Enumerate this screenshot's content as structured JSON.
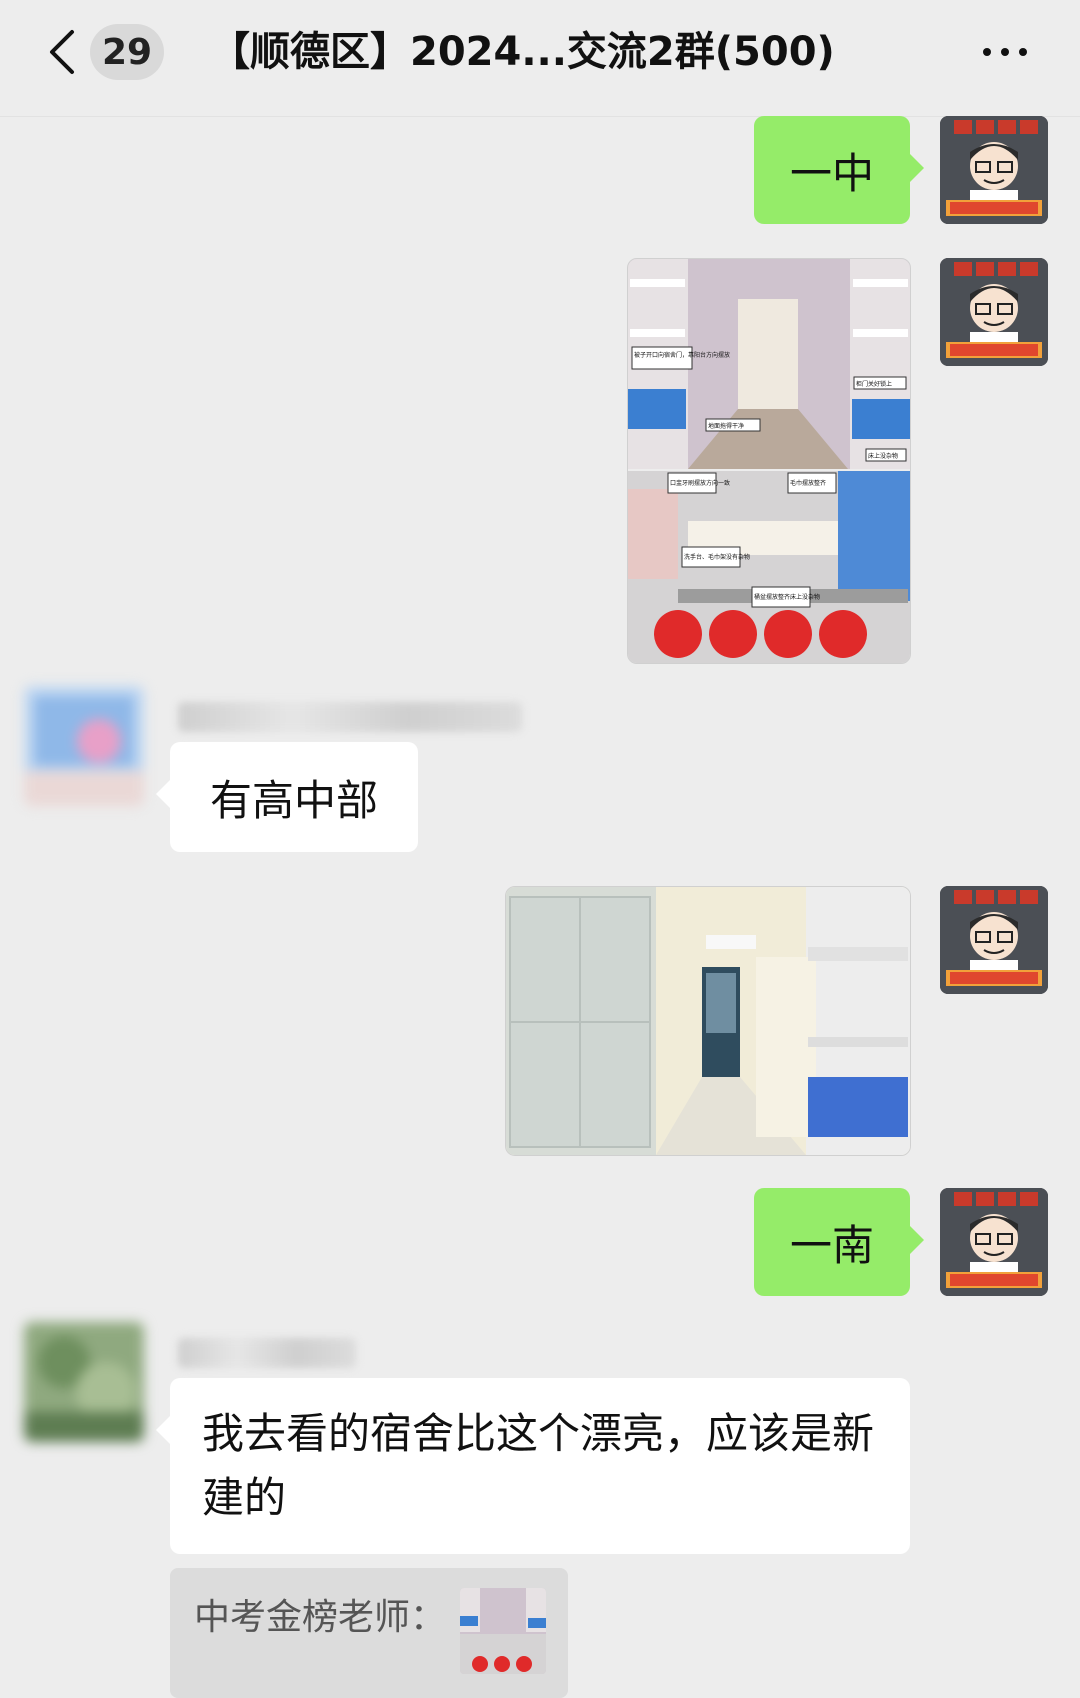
{
  "header": {
    "back_icon": "chevron-left-icon",
    "unread_count": "29",
    "title": "【顺德区】2024...交流2群(500)",
    "more_icon": "more-dots-icon"
  },
  "teacher": {
    "avatar_top_text": "好好学习",
    "avatar_banner_text": "中考金榜老师"
  },
  "messages": [
    {
      "id": "m1",
      "side": "right",
      "type": "text",
      "text": "一中"
    },
    {
      "id": "m2",
      "side": "right",
      "type": "image",
      "labels": [
        "被子开口向宿舍门，靠阳台方向摆放",
        "地面拖得干净",
        "柜门关好锁上",
        "床上没杂物",
        "口盅牙刷摆放方向一致",
        "毛巾摆放整齐",
        "洗手台、毛巾架没有杂物",
        "桶盆摆放整齐床上没杂物"
      ]
    },
    {
      "id": "m3",
      "side": "left",
      "type": "text",
      "text": "有高中部"
    },
    {
      "id": "m4",
      "side": "right",
      "type": "image"
    },
    {
      "id": "m5",
      "side": "right",
      "type": "text",
      "text": "一南"
    },
    {
      "id": "m6",
      "side": "left",
      "type": "text",
      "text": "我去看的宿舍比这个漂亮，应该是新建的"
    },
    {
      "id": "quote",
      "type": "quote",
      "text": "中考金榜老师："
    }
  ],
  "colors": {
    "background": "#EDEDED",
    "bubble_self": "#95EC69",
    "bubble_other": "#FFFFFF"
  }
}
